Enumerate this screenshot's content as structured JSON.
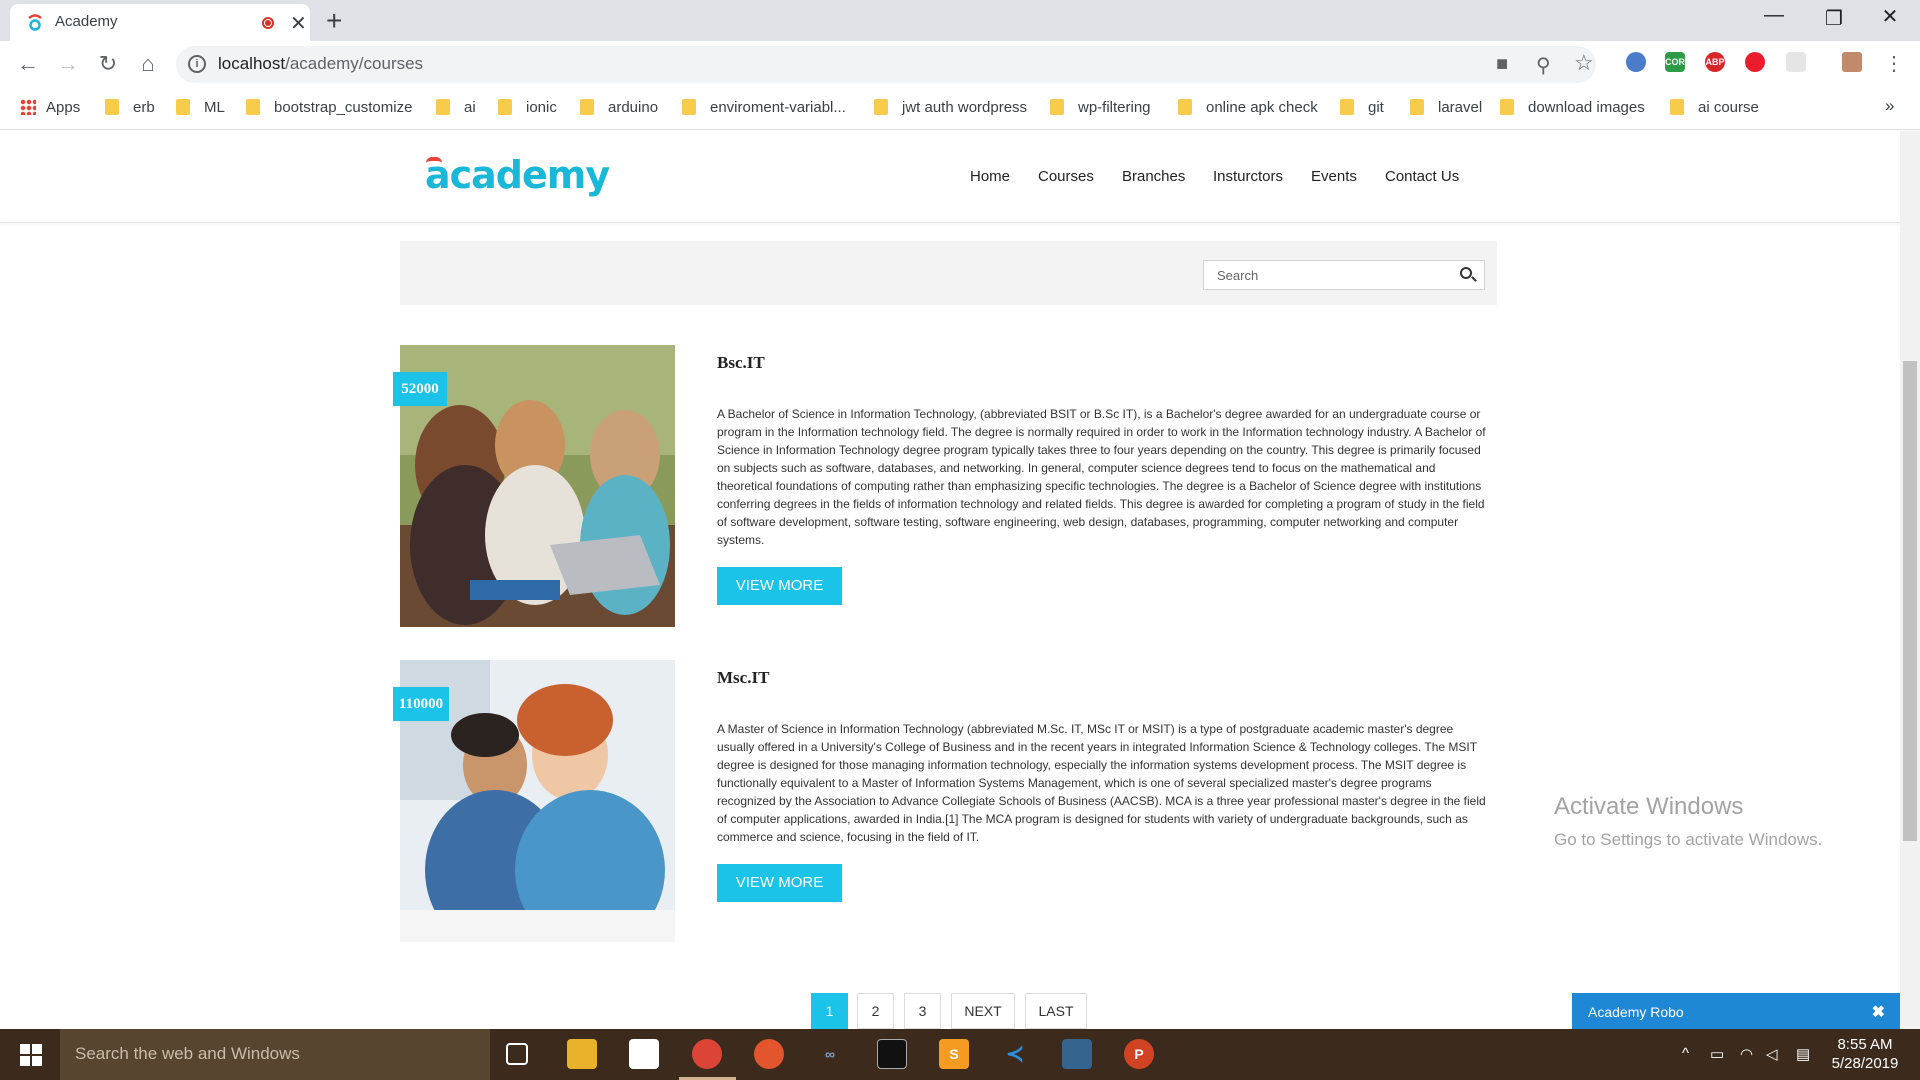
{
  "browser": {
    "tab_title": "Academy",
    "url_host": "localhost",
    "url_path": "/academy/courses",
    "bookmarks": [
      "Apps",
      "erb",
      "ML",
      "bootstrap_customize",
      "ai",
      "ionic",
      "arduino",
      "enviroment-variabl...",
      "jwt auth wordpress",
      "wp-filtering",
      "online apk check",
      "git",
      "laravel",
      "download images",
      "ai course"
    ],
    "overflow": "»",
    "extensions": {
      "cors": "CORS",
      "abp": "ABP"
    }
  },
  "site": {
    "logo": "academy",
    "nav": [
      "Home",
      "Courses",
      "Branches",
      "Insturctors",
      "Events",
      "Contact Us"
    ],
    "search_placeholder": "Search"
  },
  "courses": [
    {
      "price": "52000",
      "title": "Bsc.IT",
      "description": "A Bachelor of Science in Information Technology, (abbreviated BSIT or B.Sc IT), is a Bachelor's degree awarded for an undergraduate course or program in the Information technology field. The degree is normally required in order to work in the Information technology industry. A Bachelor of Science in Information Technology degree program typically takes three to four years depending on the country. This degree is primarily focused on subjects such as software, databases, and networking. In general, computer science degrees tend to focus on the mathematical and theoretical foundations of computing rather than emphasizing specific technologies. The degree is a Bachelor of Science degree with institutions conferring degrees in the fields of information technology and related fields. This degree is awarded for completing a program of study in the field of software development, software testing, software engineering, web design, databases, programming, computer networking and computer systems.",
      "button": "VIEW MORE"
    },
    {
      "price": "110000",
      "title": "Msc.IT",
      "description": "A Master of Science in Information Technology (abbreviated M.Sc. IT, MSc IT or MSIT) is a type of postgraduate academic master's degree usually offered in a University's College of Business and in the recent years in integrated Information Science & Technology colleges. The MSIT degree is designed for those managing information technology, especially the information systems development process. The MSIT degree is functionally equivalent to a Master of Information Systems Management, which is one of several specialized master's degree programs recognized by the Association to Advance Collegiate Schools of Business (AACSB). MCA is a three year professional master's degree in the field of computer applications, awarded in India.[1] The MCA program is designed for students with variety of undergraduate backgrounds, such as commerce and science, focusing in the field of IT.",
      "button": "VIEW MORE"
    }
  ],
  "pagination": [
    "1",
    "2",
    "3",
    "NEXT",
    "LAST"
  ],
  "watermark": {
    "title": "Activate Windows",
    "subtitle": "Go to Settings to activate Windows."
  },
  "chat_widget": {
    "label": "Academy Robo",
    "close": "✖"
  },
  "taskbar": {
    "search_placeholder": "Search the web and Windows",
    "time": "8:55 AM",
    "date": "5/28/2019"
  }
}
